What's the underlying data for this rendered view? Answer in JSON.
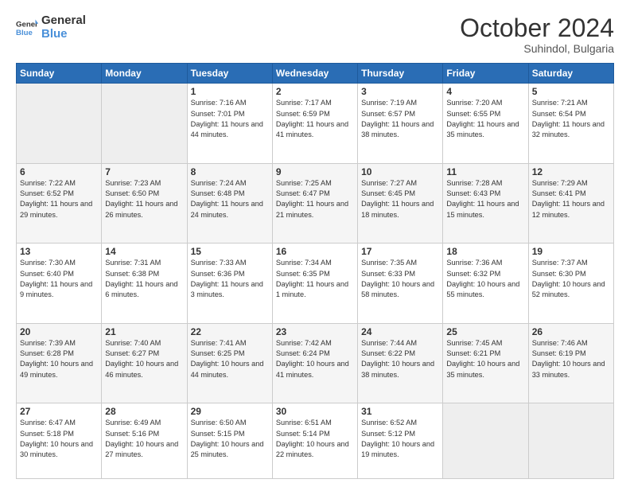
{
  "header": {
    "logo_general": "General",
    "logo_blue": "Blue",
    "month": "October 2024",
    "location": "Suhindol, Bulgaria"
  },
  "weekdays": [
    "Sunday",
    "Monday",
    "Tuesday",
    "Wednesday",
    "Thursday",
    "Friday",
    "Saturday"
  ],
  "weeks": [
    [
      {
        "day": "",
        "sunrise": "",
        "sunset": "",
        "daylight": "",
        "empty": true
      },
      {
        "day": "",
        "sunrise": "",
        "sunset": "",
        "daylight": "",
        "empty": true
      },
      {
        "day": "1",
        "sunrise": "Sunrise: 7:16 AM",
        "sunset": "Sunset: 7:01 PM",
        "daylight": "Daylight: 11 hours and 44 minutes."
      },
      {
        "day": "2",
        "sunrise": "Sunrise: 7:17 AM",
        "sunset": "Sunset: 6:59 PM",
        "daylight": "Daylight: 11 hours and 41 minutes."
      },
      {
        "day": "3",
        "sunrise": "Sunrise: 7:19 AM",
        "sunset": "Sunset: 6:57 PM",
        "daylight": "Daylight: 11 hours and 38 minutes."
      },
      {
        "day": "4",
        "sunrise": "Sunrise: 7:20 AM",
        "sunset": "Sunset: 6:55 PM",
        "daylight": "Daylight: 11 hours and 35 minutes."
      },
      {
        "day": "5",
        "sunrise": "Sunrise: 7:21 AM",
        "sunset": "Sunset: 6:54 PM",
        "daylight": "Daylight: 11 hours and 32 minutes."
      }
    ],
    [
      {
        "day": "6",
        "sunrise": "Sunrise: 7:22 AM",
        "sunset": "Sunset: 6:52 PM",
        "daylight": "Daylight: 11 hours and 29 minutes."
      },
      {
        "day": "7",
        "sunrise": "Sunrise: 7:23 AM",
        "sunset": "Sunset: 6:50 PM",
        "daylight": "Daylight: 11 hours and 26 minutes."
      },
      {
        "day": "8",
        "sunrise": "Sunrise: 7:24 AM",
        "sunset": "Sunset: 6:48 PM",
        "daylight": "Daylight: 11 hours and 24 minutes."
      },
      {
        "day": "9",
        "sunrise": "Sunrise: 7:25 AM",
        "sunset": "Sunset: 6:47 PM",
        "daylight": "Daylight: 11 hours and 21 minutes."
      },
      {
        "day": "10",
        "sunrise": "Sunrise: 7:27 AM",
        "sunset": "Sunset: 6:45 PM",
        "daylight": "Daylight: 11 hours and 18 minutes."
      },
      {
        "day": "11",
        "sunrise": "Sunrise: 7:28 AM",
        "sunset": "Sunset: 6:43 PM",
        "daylight": "Daylight: 11 hours and 15 minutes."
      },
      {
        "day": "12",
        "sunrise": "Sunrise: 7:29 AM",
        "sunset": "Sunset: 6:41 PM",
        "daylight": "Daylight: 11 hours and 12 minutes."
      }
    ],
    [
      {
        "day": "13",
        "sunrise": "Sunrise: 7:30 AM",
        "sunset": "Sunset: 6:40 PM",
        "daylight": "Daylight: 11 hours and 9 minutes."
      },
      {
        "day": "14",
        "sunrise": "Sunrise: 7:31 AM",
        "sunset": "Sunset: 6:38 PM",
        "daylight": "Daylight: 11 hours and 6 minutes."
      },
      {
        "day": "15",
        "sunrise": "Sunrise: 7:33 AM",
        "sunset": "Sunset: 6:36 PM",
        "daylight": "Daylight: 11 hours and 3 minutes."
      },
      {
        "day": "16",
        "sunrise": "Sunrise: 7:34 AM",
        "sunset": "Sunset: 6:35 PM",
        "daylight": "Daylight: 11 hours and 1 minute."
      },
      {
        "day": "17",
        "sunrise": "Sunrise: 7:35 AM",
        "sunset": "Sunset: 6:33 PM",
        "daylight": "Daylight: 10 hours and 58 minutes."
      },
      {
        "day": "18",
        "sunrise": "Sunrise: 7:36 AM",
        "sunset": "Sunset: 6:32 PM",
        "daylight": "Daylight: 10 hours and 55 minutes."
      },
      {
        "day": "19",
        "sunrise": "Sunrise: 7:37 AM",
        "sunset": "Sunset: 6:30 PM",
        "daylight": "Daylight: 10 hours and 52 minutes."
      }
    ],
    [
      {
        "day": "20",
        "sunrise": "Sunrise: 7:39 AM",
        "sunset": "Sunset: 6:28 PM",
        "daylight": "Daylight: 10 hours and 49 minutes."
      },
      {
        "day": "21",
        "sunrise": "Sunrise: 7:40 AM",
        "sunset": "Sunset: 6:27 PM",
        "daylight": "Daylight: 10 hours and 46 minutes."
      },
      {
        "day": "22",
        "sunrise": "Sunrise: 7:41 AM",
        "sunset": "Sunset: 6:25 PM",
        "daylight": "Daylight: 10 hours and 44 minutes."
      },
      {
        "day": "23",
        "sunrise": "Sunrise: 7:42 AM",
        "sunset": "Sunset: 6:24 PM",
        "daylight": "Daylight: 10 hours and 41 minutes."
      },
      {
        "day": "24",
        "sunrise": "Sunrise: 7:44 AM",
        "sunset": "Sunset: 6:22 PM",
        "daylight": "Daylight: 10 hours and 38 minutes."
      },
      {
        "day": "25",
        "sunrise": "Sunrise: 7:45 AM",
        "sunset": "Sunset: 6:21 PM",
        "daylight": "Daylight: 10 hours and 35 minutes."
      },
      {
        "day": "26",
        "sunrise": "Sunrise: 7:46 AM",
        "sunset": "Sunset: 6:19 PM",
        "daylight": "Daylight: 10 hours and 33 minutes."
      }
    ],
    [
      {
        "day": "27",
        "sunrise": "Sunrise: 6:47 AM",
        "sunset": "Sunset: 5:18 PM",
        "daylight": "Daylight: 10 hours and 30 minutes."
      },
      {
        "day": "28",
        "sunrise": "Sunrise: 6:49 AM",
        "sunset": "Sunset: 5:16 PM",
        "daylight": "Daylight: 10 hours and 27 minutes."
      },
      {
        "day": "29",
        "sunrise": "Sunrise: 6:50 AM",
        "sunset": "Sunset: 5:15 PM",
        "daylight": "Daylight: 10 hours and 25 minutes."
      },
      {
        "day": "30",
        "sunrise": "Sunrise: 6:51 AM",
        "sunset": "Sunset: 5:14 PM",
        "daylight": "Daylight: 10 hours and 22 minutes."
      },
      {
        "day": "31",
        "sunrise": "Sunrise: 6:52 AM",
        "sunset": "Sunset: 5:12 PM",
        "daylight": "Daylight: 10 hours and 19 minutes."
      },
      {
        "day": "",
        "sunrise": "",
        "sunset": "",
        "daylight": "",
        "empty": true
      },
      {
        "day": "",
        "sunrise": "",
        "sunset": "",
        "daylight": "",
        "empty": true
      }
    ]
  ]
}
